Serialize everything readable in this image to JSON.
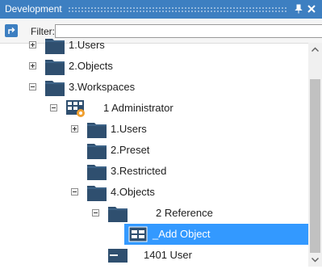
{
  "panel": {
    "title": "Development",
    "pin_icon": "pin-icon",
    "close_icon": "close-icon",
    "accent": "#3d7fc1"
  },
  "toolbar": {
    "action_icon": "arrow-up-right-icon",
    "filter_label": "Filter:",
    "filter_value": "",
    "filter_placeholder": ""
  },
  "tree": {
    "selection_color": "#3399ff",
    "folder_color": "#2f4f6f",
    "nodes": [
      {
        "label": "1.Users",
        "icon": "folder-icon",
        "expander": "plus",
        "depth": 1
      },
      {
        "label": "2.Objects",
        "icon": "folder-icon",
        "expander": "plus",
        "depth": 1
      },
      {
        "label": "3.Workspaces",
        "icon": "folder-icon",
        "expander": "minus",
        "depth": 1
      },
      {
        "label": "1 Administrator",
        "icon": "workspace-icon",
        "expander": "minus",
        "depth": 2
      },
      {
        "label": "1.Users",
        "icon": "folder-icon",
        "expander": "plus",
        "depth": 3
      },
      {
        "label": "2.Preset",
        "icon": "folder-icon",
        "expander": "none",
        "depth": 3
      },
      {
        "label": "3.Restricted",
        "icon": "folder-icon",
        "expander": "none",
        "depth": 3
      },
      {
        "label": "4.Objects",
        "icon": "folder-icon",
        "expander": "minus",
        "depth": 3
      },
      {
        "label": "2 Reference",
        "icon": "folder-icon",
        "expander": "minus",
        "depth": 4
      },
      {
        "label": "_Add Object",
        "icon": "object-icon",
        "expander": "none",
        "depth": 5,
        "selected": true
      },
      {
        "label": "1401 User",
        "icon": "window-icon",
        "expander": "none",
        "depth": 4
      }
    ]
  },
  "scrollbar": {
    "up_icon": "scroll-up-arrow-icon",
    "down_icon": "scroll-down-arrow-icon"
  }
}
